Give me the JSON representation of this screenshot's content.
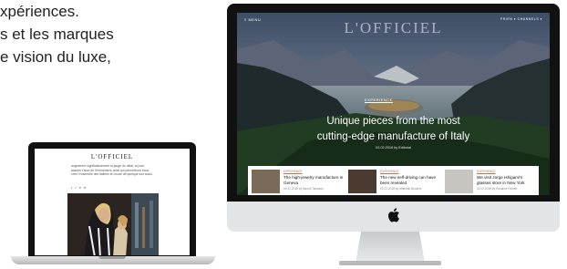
{
  "intro": {
    "line1": "xpériences.",
    "line2": "s et les marques",
    "line3": "e vision du luxe,"
  },
  "laptop": {
    "logo": "L'OFFICIEL",
    "text": "augmenter significativement la jauge du délai, et pour assurer l'aura de l'événement, ainsi qui permettront nous crée l'ensemble des Italiens en mode de quelque soit aussi.",
    "share": "f ✓ P ✉"
  },
  "imac": {
    "menu_label": "≡ MENU",
    "right_label": "FR/EN ▾  CHANNELS ▾",
    "logo": "L'OFFICIEL",
    "tag": "EXPERIENCE",
    "title_line1": "Unique pieces from the most",
    "title_line2": "cutting-edge manufacture of Italy",
    "date": "02.02.2018 by Editorial",
    "cards": [
      {
        "tag": "EXPERIENCE",
        "title": "The high-jewelry manufacture in Geneva",
        "meta": "02.02.2018 by Naomi Tanaison",
        "img_color": "#7a6a5a"
      },
      {
        "tag": "EXPERIENCE",
        "title": "The new self-driving can have been revealed",
        "meta": "02.02.2018 by Mathilde Bouliers",
        "img_color": "#4a3a30"
      },
      {
        "tag": "EXPERIENCE",
        "title": "We visit Jorge Ishigami's glasses store in New York",
        "meta": "02.02.2018 by Rosaline Palmer",
        "img_color": "#c8c4c0"
      }
    ]
  },
  "colors": {
    "accent": "#a67c52",
    "imac_silver": "#e3e4e6",
    "bezel": "#111111"
  }
}
